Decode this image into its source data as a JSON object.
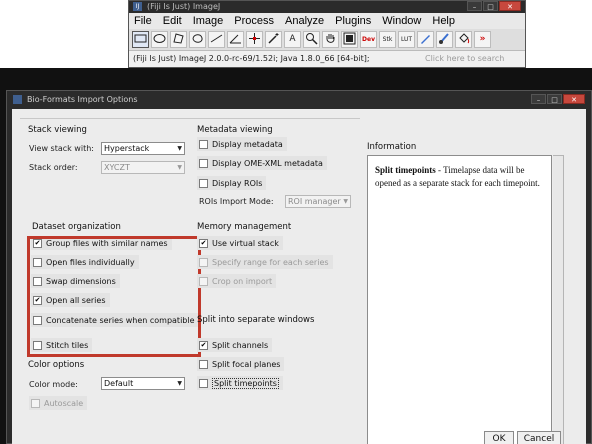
{
  "imagej": {
    "title": "(Fiji Is Just) ImageJ",
    "menus": [
      "File",
      "Edit",
      "Image",
      "Process",
      "Analyze",
      "Plugins",
      "Window",
      "Help"
    ],
    "tools": [
      "rectangle-tool",
      "oval-tool",
      "polygon-tool",
      "freehand-tool",
      "line-tool",
      "angle-tool",
      "point-tool",
      "wand-tool",
      "text-tool",
      "zoom-tool",
      "hand-tool",
      "color-picker-tool",
      "dev-tool",
      "stacks-tool",
      "lut-tool",
      "pencil-tool",
      "brush-tool",
      "flood-fill-tool",
      "more-tools"
    ],
    "tool_labels": {
      "dev": "Dev",
      "stacks": "Stk",
      "lut": "LUT",
      "more": "»",
      "text": "A"
    },
    "status": "(Fiji Is Just) ImageJ 2.0.0-rc-69/1.52i; Java 1.8.0_66 [64-bit];",
    "status_hint": "Click here to search"
  },
  "dialog": {
    "title": "Bio-Formats Import Options",
    "stack_viewing": {
      "title": "Stack viewing",
      "view_stack_with_label": "View stack with:",
      "view_stack_with_value": "Hyperstack",
      "stack_order_label": "Stack order:",
      "stack_order_value": "XYCZT"
    },
    "dataset_organization": {
      "title": "Dataset organization",
      "group_files": "Group files with similar names",
      "open_individually": "Open files individually",
      "swap_dimensions": "Swap dimensions",
      "open_all_series": "Open all series",
      "concatenate": "Concatenate series when compatible",
      "stitch_tiles": "Stitch tiles"
    },
    "color_options": {
      "title": "Color options",
      "color_mode_label": "Color mode:",
      "color_mode_value": "Default",
      "autoscale": "Autoscale"
    },
    "metadata_viewing": {
      "title": "Metadata viewing",
      "display_metadata": "Display metadata",
      "display_ome_xml": "Display OME-XML metadata",
      "display_rois": "Display ROIs",
      "rois_import_mode_label": "ROIs Import Mode:",
      "rois_import_mode_value": "ROI manager"
    },
    "memory_management": {
      "title": "Memory management",
      "use_virtual_stack": "Use virtual stack",
      "specify_range": "Specify range for each series",
      "crop_on_import": "Crop on import"
    },
    "split_windows": {
      "title": "Split into separate windows",
      "split_channels": "Split channels",
      "split_focal_planes": "Split focal planes",
      "split_timepoints": "Split timepoints"
    },
    "information": {
      "title": "Information",
      "heading": "Split timepoints",
      "body": " - Timelapse data will be opened as a separate stack for each timepoint."
    },
    "buttons": {
      "ok": "OK",
      "cancel": "Cancel"
    },
    "checks": {
      "group_files": true,
      "open_individually": false,
      "swap_dimensions": false,
      "open_all_series": true,
      "concatenate": false,
      "stitch_tiles": false,
      "autoscale": false,
      "display_metadata": false,
      "display_ome_xml": false,
      "display_rois": false,
      "use_virtual_stack": true,
      "specify_range": false,
      "crop_on_import": false,
      "split_channels": true,
      "split_focal_planes": false,
      "split_timepoints": false
    },
    "highlight_color": "#c0392b"
  }
}
